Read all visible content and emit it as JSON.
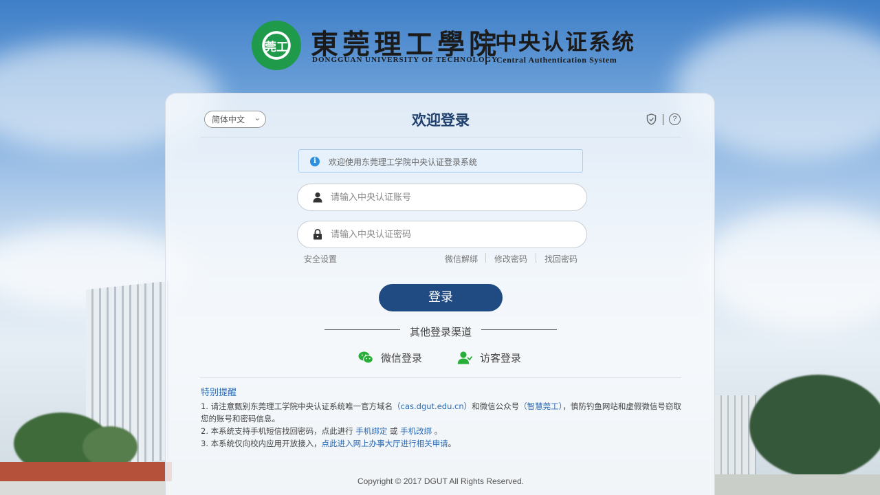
{
  "header": {
    "logo_mark": "莞工",
    "school_name_cn": "東莞理工學院",
    "school_name_en": "DONGGUAN UNIVERSITY OF TECHNOLOGY",
    "system_name_cn": "中央认证系统",
    "system_name_en": "Central Authentication System"
  },
  "login": {
    "language": "简体中文",
    "language_options": [
      "简体中文"
    ],
    "title": "欢迎登录",
    "notice": "欢迎使用东莞理工学院中央认证登录系统",
    "username_placeholder": "请输入中央认证账号",
    "password_placeholder": "请输入中央认证密码",
    "username_value": "",
    "password_value": "",
    "security_settings": "安全设置",
    "wechat_unbind": "微信解绑",
    "change_password": "修改密码",
    "recover_password": "找回密码",
    "login_button": "登录",
    "other_channels": "其他登录渠道",
    "wechat_login": "微信登录",
    "guest_login": "访客登录"
  },
  "notes": {
    "title": "特别提醒",
    "line1_a": "1. 请注意甄别东莞理工学院中央认证系统唯一官方域名",
    "line1_domain": "（cas.dgut.edu.cn）",
    "line1_b": "和微信公众号",
    "line1_wechat": "（智慧莞工）",
    "line1_c": "，慎防钓鱼网站和虚假微信号窃取您的账号和密码信息。",
    "line2_a": "2. 本系统支持手机短信找回密码，点此进行",
    "line2_bind": "手机绑定",
    "line2_or": "或",
    "line2_change": "手机改绑",
    "line2_end": "。",
    "line3_a": "3. 本系统仅向校内应用开放接入，",
    "line3_link": "点此进入网上办事大厅进行相关申请",
    "line3_end": "。"
  },
  "footer": {
    "copyright": "Copyright © 2017 DGUT All Rights Reserved."
  },
  "colors": {
    "primary": "#1f4b82",
    "title": "#1f3f6e",
    "link": "#2b6ab4",
    "brand_green": "#1f9a4b",
    "wechat_green": "#2aae3a"
  },
  "icons": [
    "shield-icon",
    "help-icon",
    "info-icon",
    "user-icon",
    "lock-icon",
    "wechat-icon",
    "guest-icon"
  ]
}
